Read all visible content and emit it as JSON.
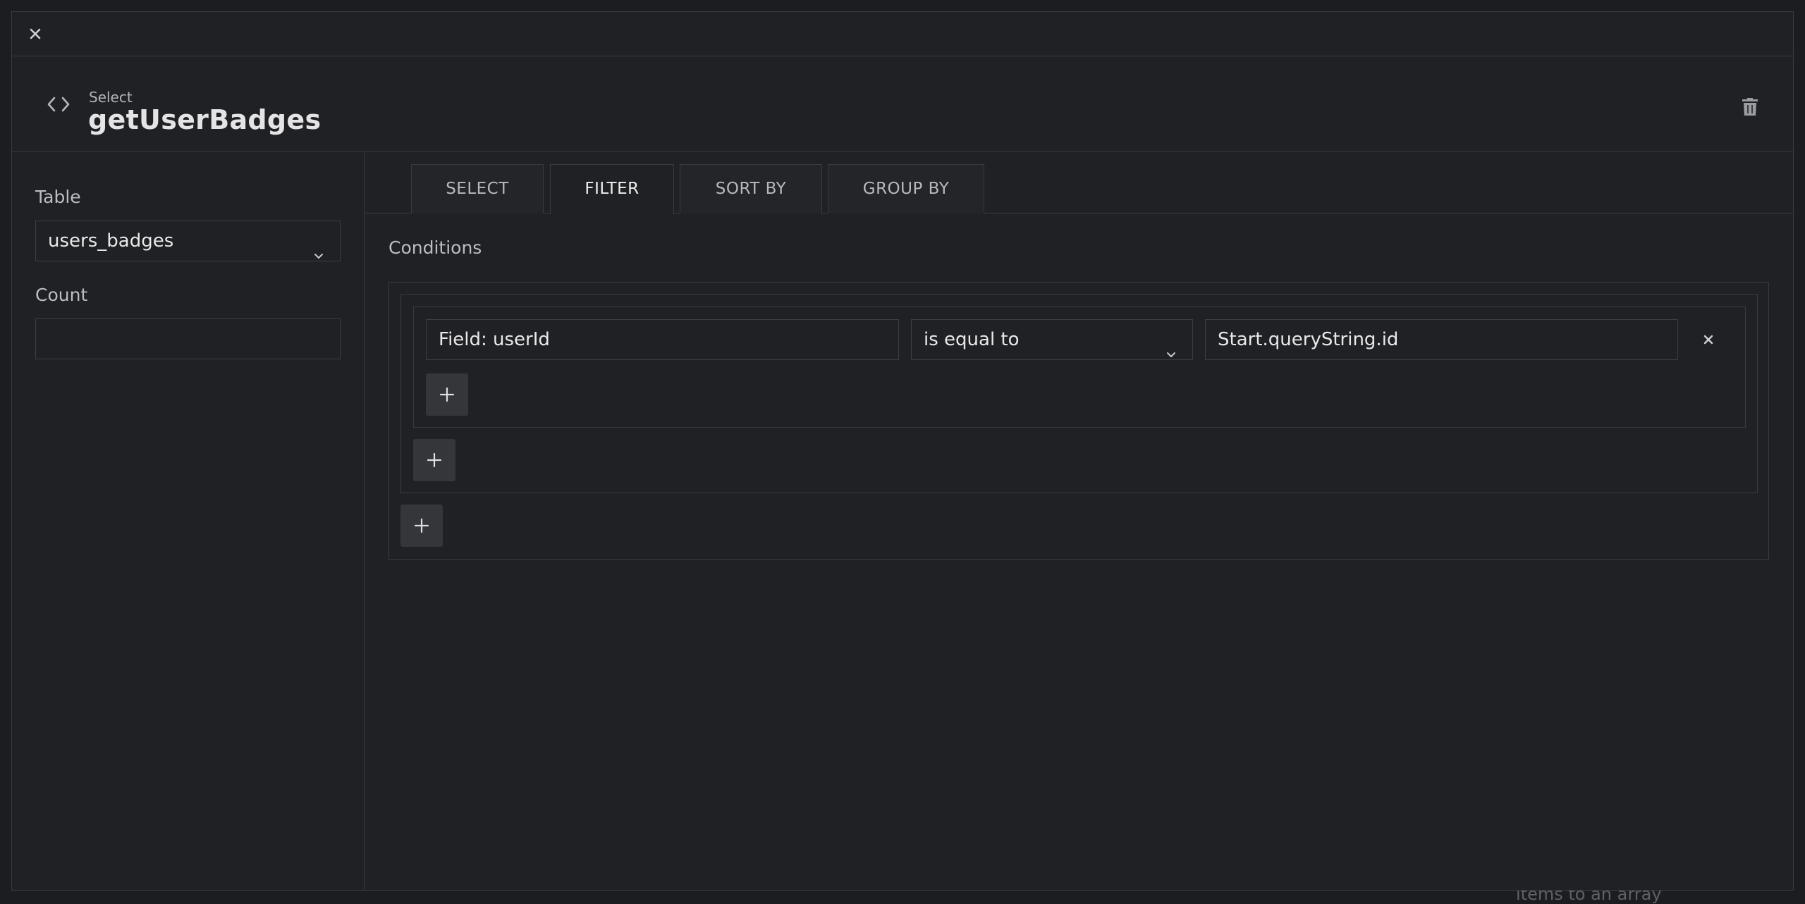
{
  "backdrop": {
    "text": "items to an array"
  },
  "topbar": {
    "close_icon": "close-icon"
  },
  "header": {
    "icon": "code-icon",
    "kind": "Select",
    "title": "getUserBadges",
    "delete_icon": "trash-icon"
  },
  "left": {
    "table_label": "Table",
    "table_value": "users_badges",
    "count_label": "Count",
    "count_value": ""
  },
  "tabs": [
    {
      "label": "SELECT",
      "active": false
    },
    {
      "label": "FILTER",
      "active": true
    },
    {
      "label": "SORT BY",
      "active": false
    },
    {
      "label": "GROUP BY",
      "active": false
    }
  ],
  "filter": {
    "conditions_label": "Conditions",
    "condition": {
      "field": "Field: userId",
      "operator": "is equal to",
      "value": "Start.queryString.id"
    }
  }
}
